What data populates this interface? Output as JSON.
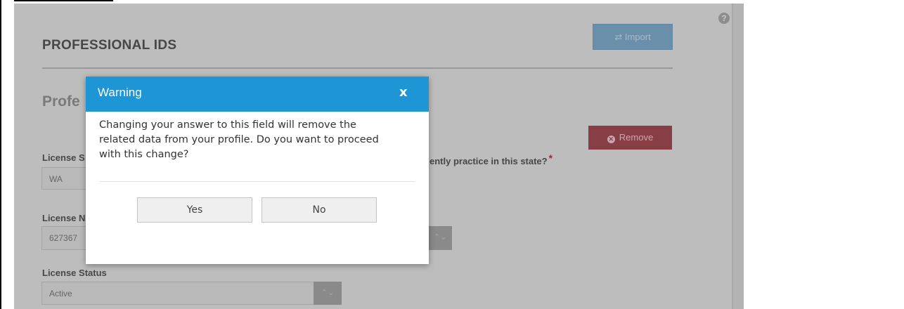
{
  "page": {
    "section_title": "PROFESSIONAL IDS",
    "import_label": "Import",
    "import_icon": "⇄",
    "subsection_visible": "Profe",
    "remove_label": "Remove",
    "remove_icon": "✕",
    "help_icon": "?",
    "state_field_label_visible": "License S",
    "state_value": "WA",
    "practice_question_visible": "ently practice in this state?",
    "required_mark": "*",
    "number_label_visible": "License N",
    "number_value_visible": "627367",
    "status_label": "License Status",
    "status_value": "Active",
    "spinner_glyph": "⌃⌄"
  },
  "modal": {
    "title": "Warning",
    "close_glyph": "x",
    "message_lines": [
      "Changing your answer to this field will remove the",
      "related data from your profile. Do you want to proceed",
      "with this change?"
    ],
    "yes_label": "Yes",
    "no_label": "No"
  },
  "colors": {
    "modal_header": "#1e95d4",
    "overlay_bg": "#bdbdbd",
    "remove_button": "#883e45",
    "import_button": "#6a8faa"
  }
}
